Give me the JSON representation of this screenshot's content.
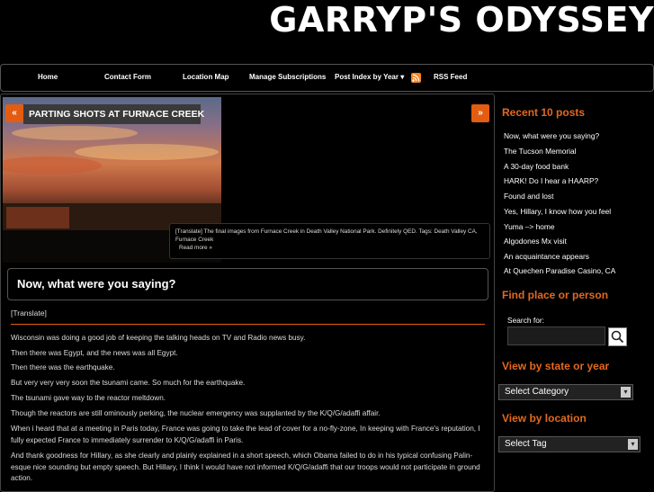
{
  "site": {
    "title": "GARRYP'S ODYSSEY"
  },
  "nav": {
    "home": "Home",
    "contact": "Contact Form",
    "location_map": "Location Map",
    "subscriptions": "Manage Subscriptions",
    "post_index": "Post Index by Year",
    "rss": "RSS Feed"
  },
  "slider": {
    "title": "PARTING SHOTS AT FURNACE CREEK",
    "prev": "«",
    "next": "»",
    "caption": "[Translate] The final images from Furnace Creek in Death Valley National Park. Definitely QED. Tags: Death Valley CA, Furnace Creek",
    "more": "Read more »"
  },
  "post": {
    "title": "Now, what were you saying?",
    "translate": "[Translate]",
    "paragraphs": [
      "Wisconsin was doing a good job of keeping the talking heads on TV and Radio news busy.",
      "Then there was Egypt, and the news was all Egypt.",
      "Then there was the earthquake.",
      "But very very very soon the tsunami came. So much for the earthquake.",
      "The tsunami gave way to the reactor meltdown.",
      "Though the reactors are still ominously perking, the nuclear emergency was supplanted by the K/Q/G/adaffi affair.",
      "When i heard that at a meeting in Paris today, France was going to take the lead of cover for a no-fly-zone, In keeping with France's reputation, I fully expected France to immediately surrender to K/Q/G/adaffi in Paris.",
      "And thank goodness for Hillary, as she clearly and plainly explained in a short speech, which Obama failed to do in his typical confusing Palin-esque nice sounding but empty speech. But Hillary, I think I would have not informed K/Q/G/adaffi that our troops would not participate in ground action."
    ]
  },
  "sidebar": {
    "recent_heading": "Recent 10 posts",
    "recent": [
      "Now, what were you saying?",
      "The Tucson Memorial",
      "A 30-day food bank",
      "HARK! Do I hear a HAARP?",
      "Found and lost",
      "Yes, Hillary, I know how you feel",
      "Yuma –> home",
      "Algodones Mx visit",
      "An acquaintance appears",
      "At Quechen Paradise Casino, CA"
    ],
    "find_heading": "Find place or person",
    "search_label": "Search for:",
    "state_heading": "View by state or year",
    "category_select": "Select Category",
    "location_heading": "View by location",
    "tag_select": "Select Tag"
  },
  "colors": {
    "accent": "#e2691e",
    "background": "#000000"
  }
}
